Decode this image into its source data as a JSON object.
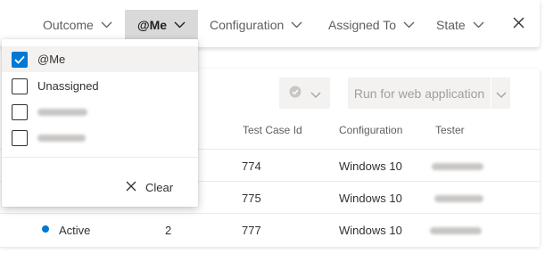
{
  "filter_bar": {
    "items": [
      {
        "label": "Outcome"
      },
      {
        "label": "@Me"
      },
      {
        "label": "Configuration"
      },
      {
        "label": "Assigned To"
      },
      {
        "label": "State"
      }
    ]
  },
  "toolbar": {
    "run_label": "Run for web application"
  },
  "table": {
    "headers": [
      "Test Case Id",
      "Configuration",
      "Tester"
    ],
    "rows": [
      {
        "test_case_id": "774",
        "configuration": "Windows 10"
      },
      {
        "test_case_id": "775",
        "configuration": "Windows 10"
      },
      {
        "state": "Active",
        "order": "2",
        "test_case_id": "777",
        "configuration": "Windows 10"
      }
    ]
  },
  "dropdown": {
    "options": [
      {
        "label": "@Me",
        "checked": true
      },
      {
        "label": "Unassigned",
        "checked": false
      },
      {
        "label": "",
        "checked": false
      },
      {
        "label": "",
        "checked": false
      }
    ],
    "clear_label": "Clear"
  },
  "colors": {
    "accent": "#0078d4",
    "active_filter_bg": "#d9d9d9",
    "disabled_text": "#a19f9d"
  },
  "icons": [
    "chevron-down-icon",
    "close-icon",
    "checkmark-icon",
    "status-check-icon",
    "clear-icon"
  ]
}
